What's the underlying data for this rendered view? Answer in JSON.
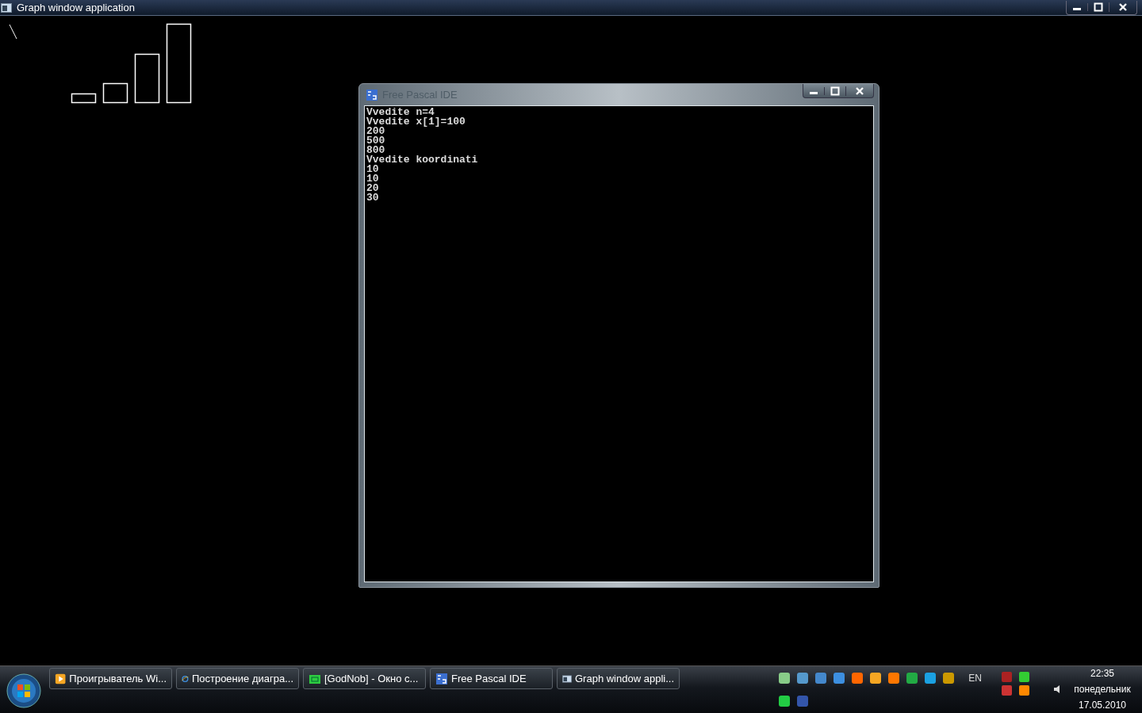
{
  "graph_window": {
    "title": "Graph window application"
  },
  "ide_window": {
    "title": "Free Pascal IDE",
    "console_lines": [
      "Vvedite n=4",
      "Vvedite x[1]=100",
      "200",
      "500",
      "800",
      "Vvedite koordinati",
      "10",
      "10",
      "20",
      "30"
    ]
  },
  "taskbar": {
    "buttons": [
      {
        "label": "Проигрыватель Wi...",
        "kind": "media"
      },
      {
        "label": "Построение диагра...",
        "kind": "browser"
      },
      {
        "label": "[GodNob] - Окно с...",
        "kind": "chat"
      },
      {
        "label": "Free Pascal IDE",
        "kind": "pascal"
      },
      {
        "label": "Graph window appli...",
        "kind": "graph"
      }
    ],
    "language": "EN",
    "clock": {
      "time": "22:35",
      "day": "понедельник",
      "date": "17.05.2010"
    }
  }
}
